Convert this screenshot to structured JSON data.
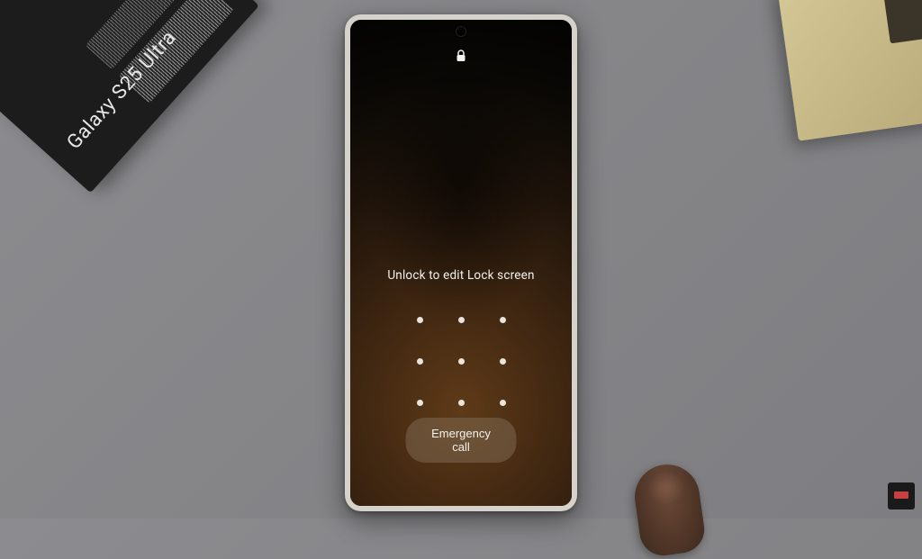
{
  "product_box": {
    "label": "Galaxy S25 Ultra"
  },
  "lockscreen": {
    "prompt": "Unlock to edit Lock screen",
    "emergency_label": "Emergency call"
  }
}
